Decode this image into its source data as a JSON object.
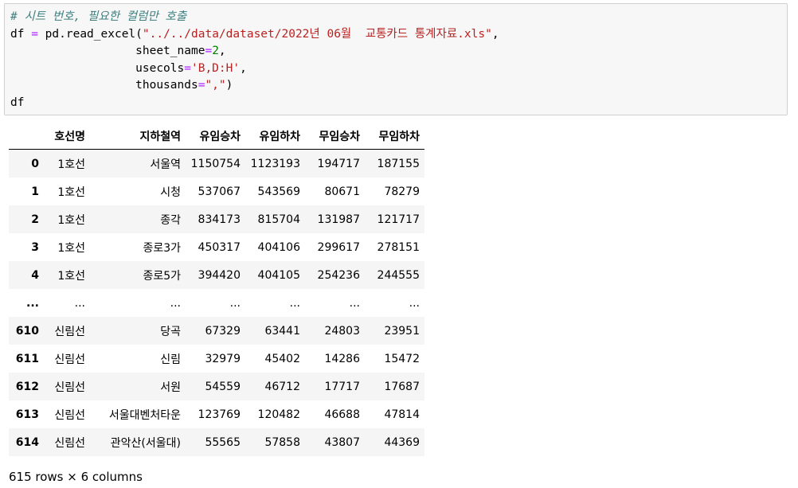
{
  "code": {
    "comment": "# 시트 번호, 필요한 컬럼만 호출",
    "line2_var": "df",
    "line2_op": "=",
    "line2_call": "pd.read_excel(",
    "line2_str": "\"../../data/dataset/2022년 06월  교통카드 통계자료.xls\"",
    "line2_tail": ",",
    "line3_key": "sheet_name",
    "line3_op": "=",
    "line3_val": "2",
    "line3_tail": ",",
    "line4_key": "usecols",
    "line4_op": "=",
    "line4_val": "'B,D:H'",
    "line4_tail": ",",
    "line5_key": "thousands",
    "line5_op": "=",
    "line5_val": "\",\"",
    "line5_tail": ")",
    "line6": "df"
  },
  "table": {
    "columns": [
      "",
      "호선명",
      "지하철역",
      "유임승차",
      "유임하차",
      "무임승차",
      "무임하차"
    ],
    "rows": [
      [
        "0",
        "1호선",
        "서울역",
        "1150754",
        "1123193",
        "194717",
        "187155"
      ],
      [
        "1",
        "1호선",
        "시청",
        "537067",
        "543569",
        "80671",
        "78279"
      ],
      [
        "2",
        "1호선",
        "종각",
        "834173",
        "815704",
        "131987",
        "121717"
      ],
      [
        "3",
        "1호선",
        "종로3가",
        "450317",
        "404106",
        "299617",
        "278151"
      ],
      [
        "4",
        "1호선",
        "종로5가",
        "394420",
        "404105",
        "254236",
        "244555"
      ],
      [
        "...",
        "...",
        "...",
        "...",
        "...",
        "...",
        "..."
      ],
      [
        "610",
        "신림선",
        "당곡",
        "67329",
        "63441",
        "24803",
        "23951"
      ],
      [
        "611",
        "신림선",
        "신림",
        "32979",
        "45402",
        "14286",
        "15472"
      ],
      [
        "612",
        "신림선",
        "서원",
        "54559",
        "46712",
        "17717",
        "17687"
      ],
      [
        "613",
        "신림선",
        "서울대벤처타운",
        "123769",
        "120482",
        "46688",
        "47814"
      ],
      [
        "614",
        "신림선",
        "관악산(서울대)",
        "55565",
        "57858",
        "43807",
        "44369"
      ]
    ]
  },
  "shape_text": "615 rows × 6 columns"
}
